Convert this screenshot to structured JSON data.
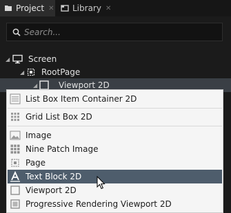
{
  "tabs": [
    {
      "label": "Project",
      "icon": "folder-icon",
      "active": true
    },
    {
      "label": "Library",
      "icon": "library-icon",
      "active": false
    }
  ],
  "search": {
    "placeholder": "Search..."
  },
  "tree": [
    {
      "label": "Screen",
      "icon": "screen-icon",
      "expanded": true
    },
    {
      "label": "RootPage",
      "icon": "page-icon",
      "expanded": true
    },
    {
      "label": "Viewport 2D",
      "icon": "viewport-icon",
      "expanded": true,
      "selected": true
    }
  ],
  "menu": {
    "items": [
      {
        "label": "List Box Item Container 2D",
        "icon": "list-box-item-icon"
      },
      {
        "label": "Grid List Box 2D",
        "icon": "grid-list-box-icon"
      },
      {
        "label": "Image",
        "icon": "image-icon"
      },
      {
        "label": "Nine Patch Image",
        "icon": "nine-patch-icon"
      },
      {
        "label": "Page",
        "icon": "page-icon"
      },
      {
        "label": "Text Block 2D",
        "icon": "text-block-icon",
        "highlighted": true
      },
      {
        "label": "Viewport 2D",
        "icon": "viewport-icon"
      },
      {
        "label": "Progressive Rendering Viewport 2D",
        "icon": "progressive-viewport-icon"
      }
    ]
  },
  "colors": {
    "accent_highlight": "#4e5d6c",
    "panel_bg": "#1b1b1b",
    "menu_bg": "#f5f5f5"
  }
}
